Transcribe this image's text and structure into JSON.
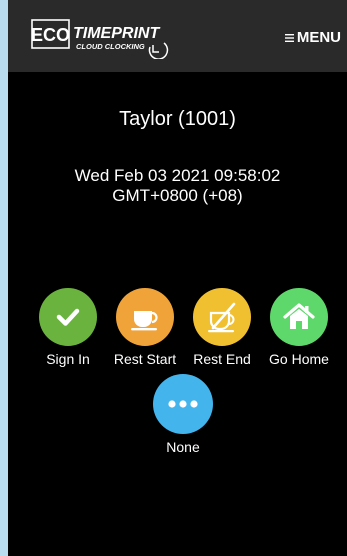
{
  "header": {
    "logo_text": "ECO TIMEPRINT CLOUD CLOCKING",
    "menu_label": "MENU"
  },
  "user": {
    "display_name": "Taylor (1001)"
  },
  "clock": {
    "date_line": "Wed Feb 03 2021 09:58:02",
    "tz_line": "GMT+0800 (+08)"
  },
  "actions": [
    {
      "label": "Sign In",
      "icon": "checkmark-icon",
      "color": "#6ab33e"
    },
    {
      "label": "Rest Start",
      "icon": "coffee-cup-icon",
      "color": "#f0a339"
    },
    {
      "label": "Rest End",
      "icon": "coffee-cup-crossed-icon",
      "color": "#f0c030"
    },
    {
      "label": "Go Home",
      "icon": "home-icon",
      "color": "#5ed86a"
    },
    {
      "label": "None",
      "icon": "dots-icon",
      "color": "#43b4ec"
    }
  ],
  "colors": {
    "page_bg": "#000000",
    "header_bg": "#2a2a2a",
    "outer_bg": "#b9dcef",
    "text": "#ffffff"
  }
}
